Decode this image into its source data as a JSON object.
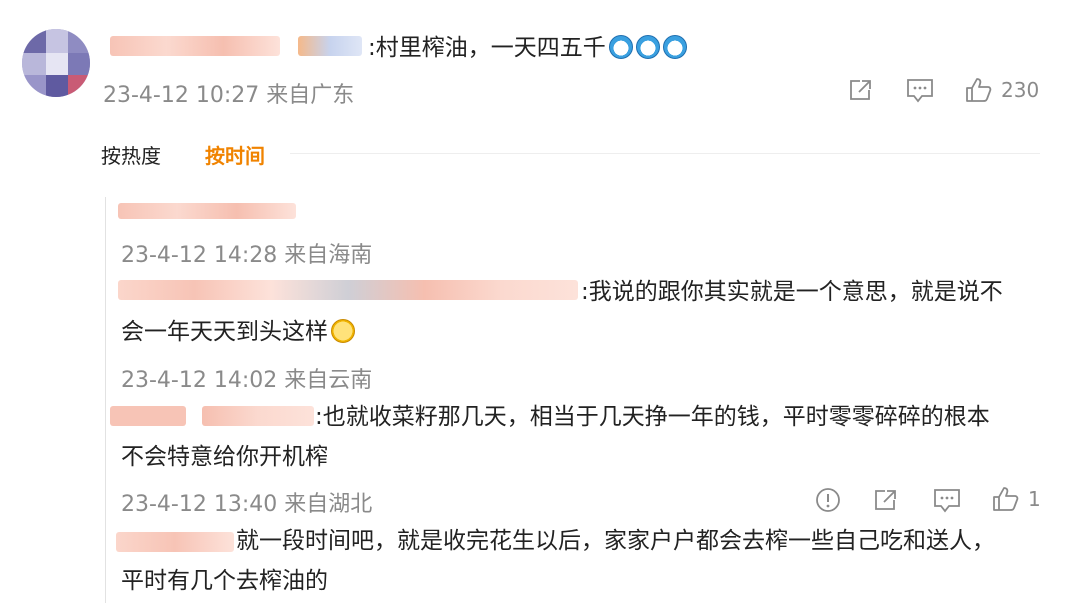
{
  "comment": {
    "text": ":村里榨油，一天四五千",
    "emojis": [
      "doge-emoji",
      "doge-emoji",
      "doge-emoji"
    ],
    "date": "23-4-12 10:27",
    "location": "来自广东",
    "likes": "230"
  },
  "sort": {
    "hot": "按热度",
    "time": "按时间"
  },
  "replies": [
    {
      "date": "23-4-12 14:28",
      "location": "来自海南"
    },
    {
      "text_line1": ":我说的跟你其实就是一个意思，就是说不",
      "text_line2": "会一年天天到头这样",
      "date": "23-4-12 14:02",
      "location": "来自云南"
    },
    {
      "text_line1": ":也就收菜籽那几天，相当于几天挣一年的钱，平时零零碎碎的根本",
      "text_line2": "不会特意给你开机榨",
      "date": "23-4-12 13:40",
      "location": "来自湖北",
      "likes": "1"
    },
    {
      "text_line1": "就一段时间吧，就是收完花生以后，家家户户都会去榨一些自己吃和送人，",
      "text_line2": "平时有几个去榨油的"
    }
  ],
  "colors": {
    "accent": "#f08300",
    "meta": "#8a8a8a",
    "redaction": "#f7c9bd"
  }
}
